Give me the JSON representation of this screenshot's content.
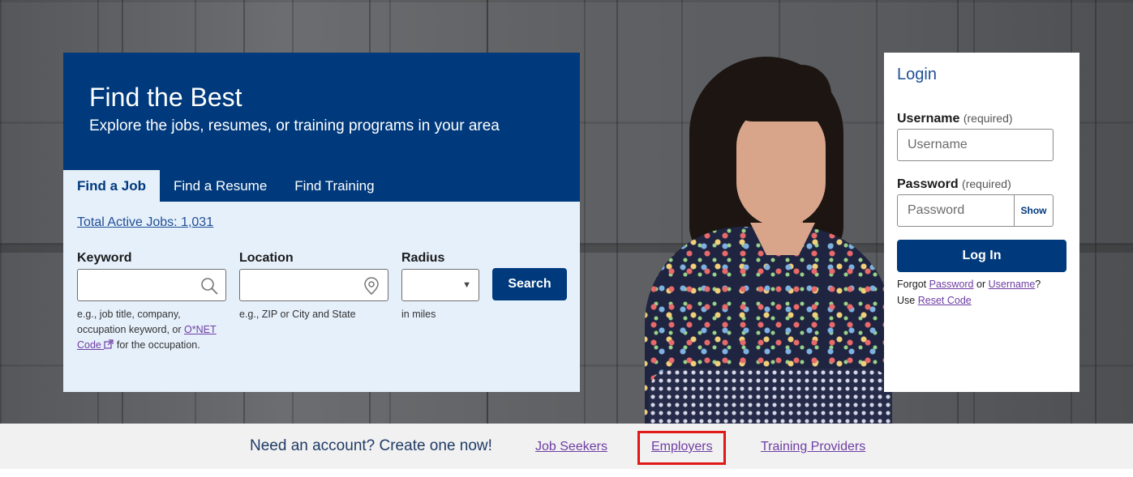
{
  "search": {
    "title": "Find the Best",
    "subtitle": "Explore the jobs, resumes, or training programs in your area",
    "tabs": [
      {
        "label": "Find a Job",
        "active": true
      },
      {
        "label": "Find a Resume",
        "active": false
      },
      {
        "label": "Find Training",
        "active": false
      }
    ],
    "total_jobs_link": "Total Active Jobs: 1,031",
    "keyword": {
      "label": "Keyword",
      "value": "",
      "icon": "search-icon",
      "hint_before": "e.g., job title, company, occupation keyword, or",
      "hint_link": "O*NET Code",
      "hint_after": "for the occupation."
    },
    "location": {
      "label": "Location",
      "value": "",
      "icon": "map-pin-icon",
      "hint": "e.g., ZIP or City and State"
    },
    "radius": {
      "label": "Radius",
      "selected": "",
      "hint": "in miles"
    },
    "search_button": "Search"
  },
  "login": {
    "title": "Login",
    "username_label": "Username",
    "username_required": "(required)",
    "username_placeholder": "Username",
    "password_label": "Password",
    "password_required": "(required)",
    "password_placeholder": "Password",
    "show_button": "Show",
    "login_button": "Log In",
    "forgot_prefix": "Forgot",
    "forgot_password_link": "Password",
    "forgot_or": "or",
    "forgot_username_link": "Username",
    "forgot_suffix": "?",
    "use_prefix": "Use",
    "reset_code_link": "Reset Code"
  },
  "account_bar": {
    "text": "Need an account? Create one now!",
    "links": [
      "Job Seekers",
      "Employers",
      "Training Providers"
    ],
    "highlighted": "Employers"
  },
  "colors": {
    "brand_navy": "#003a7d",
    "panel_light": "#e6f0fb",
    "link_purple": "#6e3da3",
    "highlight_red": "#e01818"
  }
}
